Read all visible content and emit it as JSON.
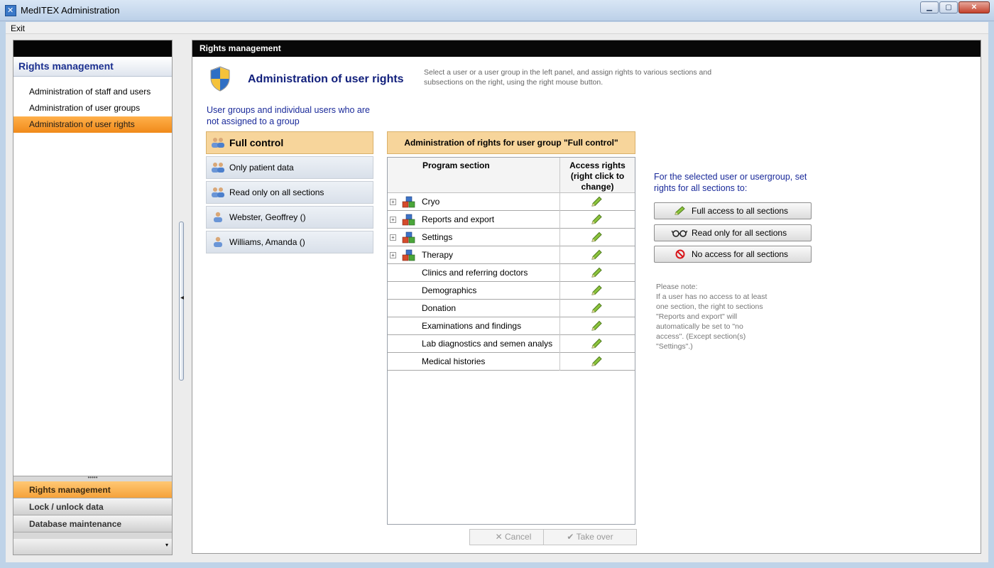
{
  "window": {
    "title": "MedITEX Administration",
    "buttons": {
      "minimize": "▁",
      "maximize": "▢",
      "close": "✕"
    }
  },
  "menu": {
    "exit": "Exit"
  },
  "nav": {
    "header": "Rights management",
    "items": [
      {
        "label": "Administration of staff and users",
        "active": false
      },
      {
        "label": "Administration of user groups",
        "active": false
      },
      {
        "label": "Administration of user rights",
        "active": true
      }
    ],
    "grip": "•••••",
    "bottom": [
      {
        "label": "Rights management",
        "active": true
      },
      {
        "label": "Lock / unlock data",
        "active": false
      },
      {
        "label": "Database maintenance",
        "active": false
      }
    ],
    "more_arrow": "▾"
  },
  "splitter_arrow": "◂",
  "main": {
    "header": "Rights management",
    "title": "Administration of user rights",
    "intro": "Select a user or a user group in the left panel, and assign rights to various sections and subsections on the right, using the right mouse button.",
    "groups_caption": "User groups and individual users who are not assigned to a group",
    "groups": [
      {
        "label": "Full control",
        "type": "group",
        "active": true
      },
      {
        "label": "Only patient data",
        "type": "group",
        "active": false
      },
      {
        "label": "Read only on all sections",
        "type": "group",
        "active": false
      },
      {
        "label": "Webster, Geoffrey  ()",
        "type": "user",
        "active": false
      },
      {
        "label": "Williams, Amanda  ()",
        "type": "user",
        "active": false
      }
    ],
    "rights_header": "Administration of rights for user group \"Full control\"",
    "table": {
      "col_section": "Program section",
      "col_rights": "Access rights (right click to change)",
      "rows": [
        {
          "label": "Cryo",
          "expandable": true
        },
        {
          "label": "Reports and export",
          "expandable": true
        },
        {
          "label": "Settings",
          "expandable": true
        },
        {
          "label": "Therapy",
          "expandable": true
        },
        {
          "label": "Clinics and referring doctors",
          "expandable": false
        },
        {
          "label": "Demographics",
          "expandable": false
        },
        {
          "label": "Donation",
          "expandable": false
        },
        {
          "label": "Examinations and findings",
          "expandable": false
        },
        {
          "label": "Lab diagnostics and semen analys",
          "expandable": false
        },
        {
          "label": "Medical histories",
          "expandable": false
        }
      ],
      "expand_glyph": "+"
    },
    "cancel": "Cancel",
    "take_over": "Take over",
    "cancel_icon": "✕",
    "take_over_icon": "✔",
    "set_caption": "For the selected user or usergroup, set rights for all sections to:",
    "full_access": "Full access to all sections",
    "read_only": "Read only for all sections",
    "no_access": "No access for all sections",
    "note": "Please note:\nIf a user has no access to at least one section, the right to sections \"Reports and export\" will automatically be set to \"no access\". (Except section(s) \"Settings\".)"
  },
  "colors": {
    "accent_orange": "#f08a1a",
    "selection_tan": "#f7d59b",
    "title_blue": "#12207c",
    "pencil_green": "#6aa82a"
  }
}
